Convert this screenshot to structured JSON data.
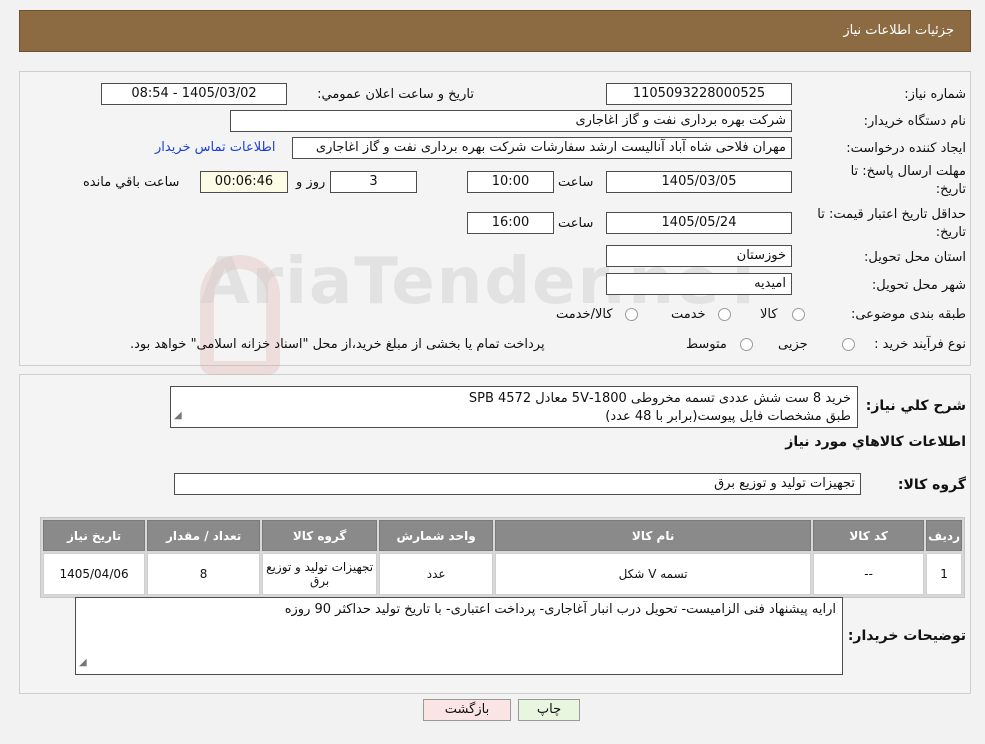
{
  "header": {
    "title": "جزئیات اطلاعات نیاز"
  },
  "watermark": {
    "text": "AriaTender.neT"
  },
  "need": {
    "number_label": "شماره نیاز:",
    "number": "1105093228000525",
    "announce_label": "تاریخ و ساعت اعلان عمومي:",
    "announce_value": "1405/03/02 - 08:54",
    "buyer_org_label": "نام دستگاه خريدار:",
    "buyer_org": "شرکت بهره برداری نفت و گاز اغاجاری",
    "creator_label": "ایجاد کننده درخواست:",
    "creator": "مهران فلاحی شاه آباد آنالیست ارشد سفارشات شرکت بهره برداری نفت و گاز اغاجاری",
    "contact_link": "اطلاعات تماس خریدار",
    "deadline_label_1": "مهلت ارسال پاسخ: تا",
    "deadline_label_2": "تاریخ:",
    "deadline_date": "1405/03/05",
    "time_label": "ساعت",
    "deadline_time": "10:00",
    "days": "3",
    "days_label": "روز و",
    "remaining": "00:06:46",
    "remaining_label": "ساعت باقي مانده",
    "validity_label_1": "حداقل تاریخ اعتبار قیمت: تا",
    "validity_label_2": "تاریخ:",
    "validity_date": "1405/05/24",
    "validity_time": "16:00",
    "province_label": "استان محل تحویل:",
    "province": "خوزستان",
    "city_label": "شهر محل تحویل:",
    "city": "امیدیه",
    "category_label": "طبقه بندی موضوعی:",
    "category_options": [
      "کالا",
      "خدمت",
      "کالا/خدمت"
    ],
    "process_label": "نوع فرآیند خرید :",
    "process_options": [
      "جزیی",
      "متوسط"
    ],
    "process_note": "پرداخت تمام یا بخشی از مبلغ خرید،از محل \"اسناد خزانه اسلامی\" خواهد بود."
  },
  "description": {
    "label": "شرح کلي نياز:",
    "line1": "خرید 8 ست شش عددی تسمه مخروطی 1800-5V معادل SPB 4572",
    "line2": "طبق مشخصات فایل پیوست(برابر با 48 عدد)"
  },
  "goods": {
    "section_title": "اطلاعات کالاهاي مورد نياز",
    "group_label": "گروه کالا:",
    "group_value": "تجهیزات تولید و توزیع برق",
    "columns": [
      "رديف",
      "کد کالا",
      "نام کالا",
      "واحد شمارش",
      "گروه کالا",
      "تعداد / مقدار",
      "تاريخ نياز"
    ],
    "rows": [
      [
        "1",
        "--",
        "تسمه V شکل",
        "عدد",
        "تجهیزات تولید و توزیع برق",
        "8",
        "1405/04/06"
      ]
    ]
  },
  "notes": {
    "label": "توضیحات خریدار:",
    "text": "ارایه پیشنهاد فنی الزامیست- تحویل درب انبار آغاجاری- پرداخت اعتباری- با تاریخ تولید حداکثر 90 روزه"
  },
  "buttons": {
    "print": "چاپ",
    "back": "بازگشت"
  }
}
